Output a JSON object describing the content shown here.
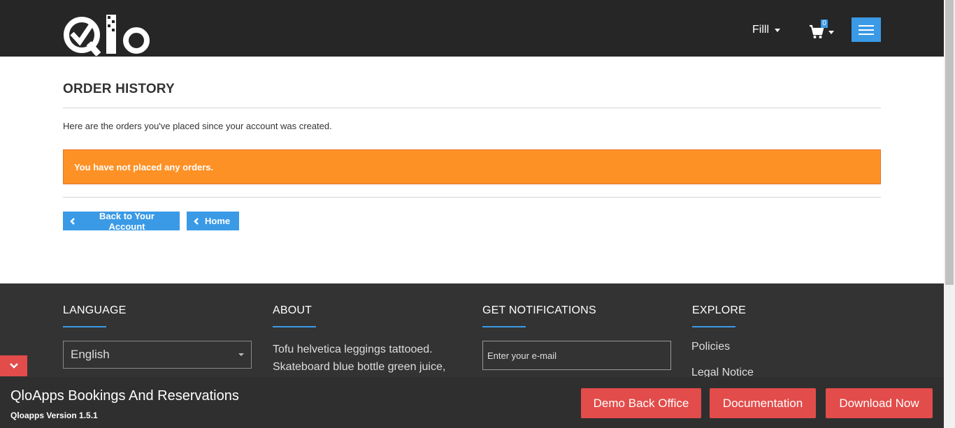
{
  "header": {
    "logo_text": "Qlo",
    "user_name": "Filll",
    "cart_count": "0"
  },
  "main": {
    "title": "ORDER HISTORY",
    "intro": "Here are the orders you've placed since your account was created.",
    "alert": "You have not placed any orders.",
    "back_button": "Back to Your Account",
    "home_button": "Home"
  },
  "footer": {
    "language": {
      "heading": "LANGUAGE",
      "selected": "English"
    },
    "about": {
      "heading": "ABOUT",
      "text": "Tofu helvetica leggings tattooed. Skateboard blue bottle green juice,"
    },
    "notifications": {
      "heading": "GET NOTIFICATIONS",
      "email_placeholder": "Enter your e-mail"
    },
    "explore": {
      "heading": "EXPLORE",
      "links": [
        "Policies",
        "Legal Notice"
      ]
    }
  },
  "demobar": {
    "title": "QloApps Bookings And Reservations",
    "version": "Qloapps Version 1.5.1",
    "buttons": [
      "Demo Back Office",
      "Documentation",
      "Download Now"
    ]
  },
  "colors": {
    "header_bg": "#262626",
    "accent_blue": "#3a9ae6",
    "alert_orange": "#fe9126",
    "footer_bg": "#333333",
    "demo_red": "#e24c4a"
  },
  "icons": [
    "qlo-logo",
    "caret-down-icon",
    "cart-icon",
    "hamburger-icon",
    "chevron-left-icon",
    "chevron-down-icon"
  ]
}
